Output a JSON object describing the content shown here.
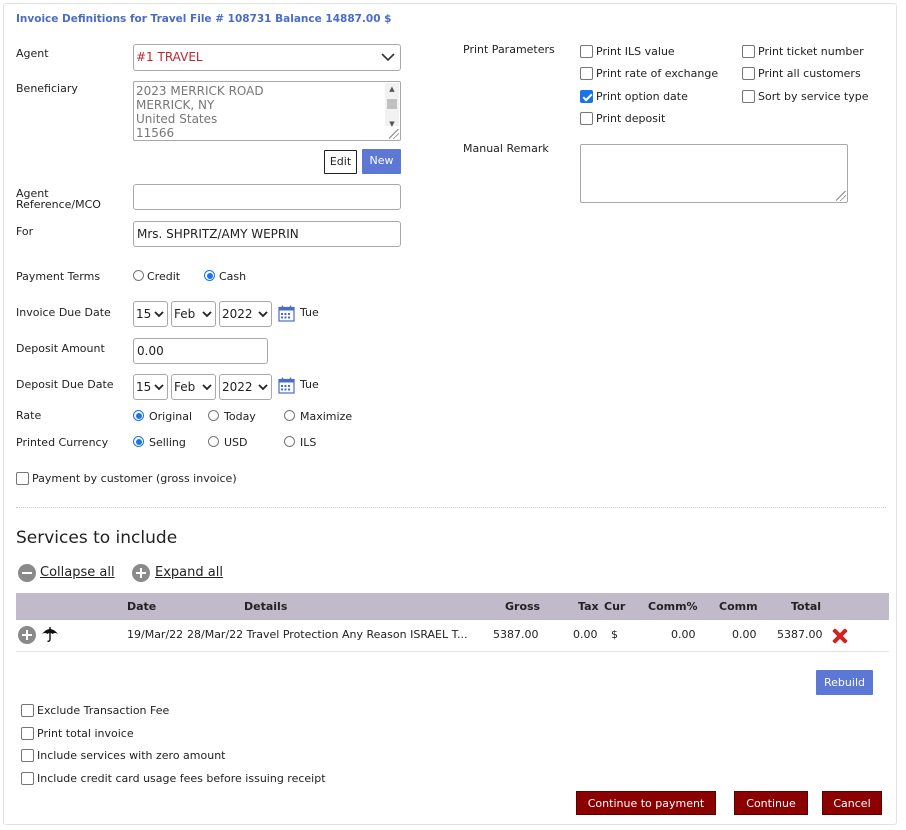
{
  "header": {
    "title": "Invoice Definitions for Travel File # 108731 Balance 14887.00 $"
  },
  "form": {
    "agent": {
      "label": "Agent",
      "value": "#1 TRAVEL"
    },
    "beneficiary": {
      "label": "Beneficiary",
      "value": "2023 MERRICK ROAD\nMERRICK, NY\nUnited States\n11566"
    },
    "edit_label": "Edit",
    "new_label": "New",
    "agent_reference": {
      "label": "Agent Reference/MCO",
      "value": ""
    },
    "for": {
      "label": "For",
      "value": "Mrs. SHPRITZ/AMY WEPRIN"
    },
    "payment_terms": {
      "label": "Payment Terms",
      "options": [
        "Credit",
        "Cash"
      ],
      "selected": "Cash"
    },
    "invoice_due_date": {
      "label": "Invoice Due Date",
      "day": "15",
      "month": "Feb",
      "year": "2022",
      "weekday": "Tue"
    },
    "deposit_amount": {
      "label": "Deposit Amount",
      "value": "0.00"
    },
    "deposit_due_date": {
      "label": "Deposit Due Date",
      "day": "15",
      "month": "Feb",
      "year": "2022",
      "weekday": "Tue"
    },
    "rate": {
      "label": "Rate",
      "options": [
        "Original",
        "Today",
        "Maximize"
      ],
      "selected": "Original"
    },
    "printed_currency": {
      "label": "Printed Currency",
      "options": [
        "Selling",
        "USD",
        "ILS"
      ],
      "selected": "Selling"
    },
    "payment_by_customer": {
      "label": "Payment by customer (gross invoice)",
      "checked": false
    }
  },
  "print_parameters": {
    "label": "Print Parameters",
    "options": [
      {
        "label": "Print ILS value",
        "checked": false
      },
      {
        "label": "Print ticket number",
        "checked": false
      },
      {
        "label": "Print rate of exchange",
        "checked": false
      },
      {
        "label": "Print all customers",
        "checked": false
      },
      {
        "label": "Print option date",
        "checked": true
      },
      {
        "label": "Sort by service type",
        "checked": false
      },
      {
        "label": "Print deposit",
        "checked": false
      }
    ]
  },
  "manual_remark": {
    "label": "Manual Remark",
    "value": ""
  },
  "services": {
    "title": "Services to include",
    "collapse_all": "Collapse all",
    "expand_all": "Expand all",
    "columns": [
      "Date",
      "Details",
      "Gross",
      "Tax",
      "Cur",
      "Comm%",
      "Comm",
      "Total"
    ],
    "rows": [
      {
        "date": "19/Mar/22",
        "details": "28/Mar/22 Travel Protection Any Reason ISRAEL T...",
        "gross": "5387.00",
        "tax": "0.00",
        "cur": "$",
        "comm_pct": "0.00",
        "comm": "0.00",
        "total": "5387.00"
      }
    ],
    "rebuild_label": "Rebuild"
  },
  "options": [
    {
      "label": "Exclude Transaction Fee",
      "checked": false
    },
    {
      "label": "Print total invoice",
      "checked": false
    },
    {
      "label": "Include services with zero amount",
      "checked": false
    },
    {
      "label": "Include credit card usage fees before issuing receipt",
      "checked": false
    }
  ],
  "footer": {
    "continue_to_payment": "Continue to payment",
    "continue": "Continue",
    "cancel": "Cancel"
  },
  "colors": {
    "accent_blue": "#5c78d4",
    "title_blue": "#4a6cc7",
    "dark_red": "#8b0000",
    "table_header": "#c0bacb",
    "agent_text": "#c0272d"
  }
}
